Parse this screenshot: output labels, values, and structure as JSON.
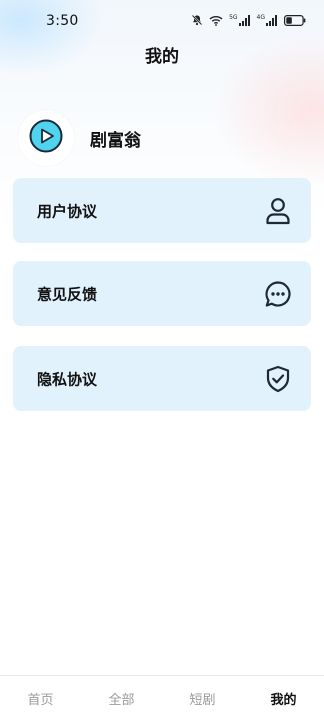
{
  "status_bar": {
    "time": "3:50",
    "network_1": "5G",
    "network_2": "4G",
    "icons": [
      "mute-bell-icon",
      "wifi-icon",
      "signal-5g-icon",
      "signal-4g-icon",
      "battery-icon"
    ]
  },
  "header": {
    "title": "我的"
  },
  "profile": {
    "name": "剧富翁",
    "avatar_icon": "play-icon",
    "avatar_color": "#4fd3ee"
  },
  "menu": {
    "items": [
      {
        "label": "用户协议",
        "icon": "user-icon"
      },
      {
        "label": "意见反馈",
        "icon": "chat-bubble-icon"
      },
      {
        "label": "隐私协议",
        "icon": "shield-check-icon"
      }
    ],
    "card_color": "#e2f2fc"
  },
  "tabs": [
    {
      "label": "首页",
      "active": false
    },
    {
      "label": "全部",
      "active": false
    },
    {
      "label": "短剧",
      "active": false
    },
    {
      "label": "我的",
      "active": true
    }
  ]
}
